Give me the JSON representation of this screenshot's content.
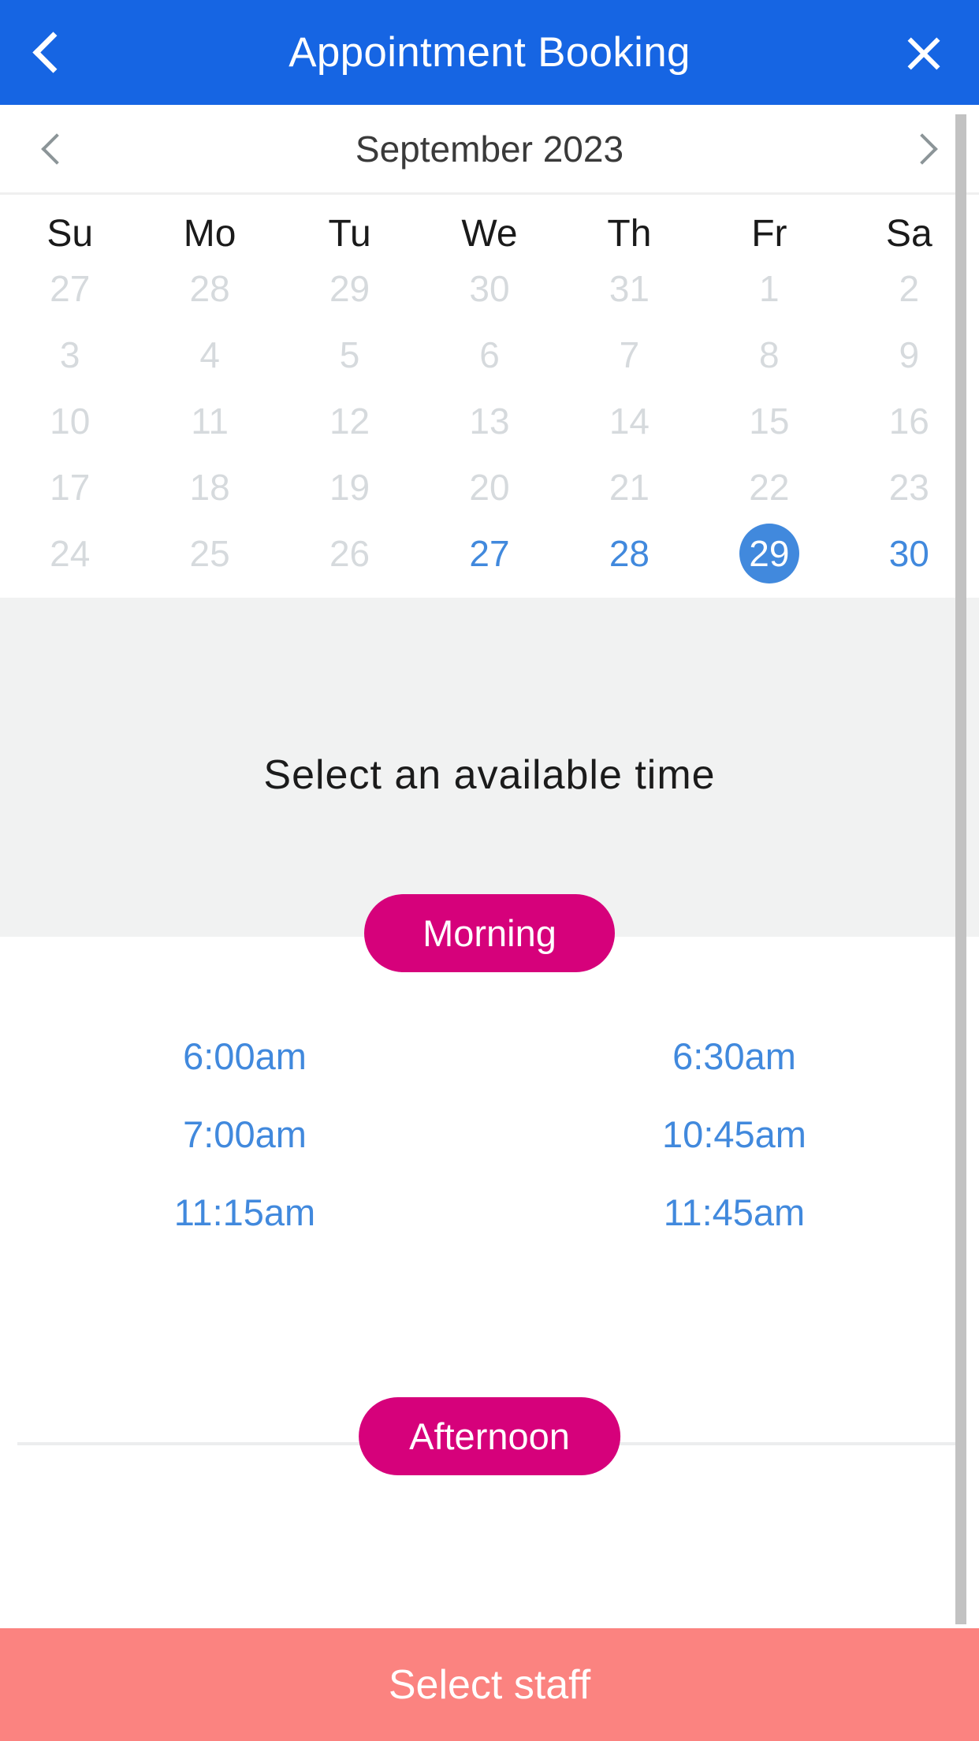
{
  "header": {
    "title": "Appointment Booking",
    "back_icon": "chevron-left-icon",
    "close_icon": "close-icon",
    "background_color": "#1665E3"
  },
  "calendar": {
    "month_label": "September 2023",
    "prev_icon": "chevron-left-icon",
    "next_icon": "chevron-right-icon",
    "weekdays": [
      "Su",
      "Mo",
      "Tu",
      "We",
      "Th",
      "Fr",
      "Sa"
    ],
    "days": [
      {
        "label": "27",
        "state": "disabled"
      },
      {
        "label": "28",
        "state": "disabled"
      },
      {
        "label": "29",
        "state": "disabled"
      },
      {
        "label": "30",
        "state": "disabled"
      },
      {
        "label": "31",
        "state": "disabled"
      },
      {
        "label": "1",
        "state": "disabled"
      },
      {
        "label": "2",
        "state": "disabled"
      },
      {
        "label": "3",
        "state": "disabled"
      },
      {
        "label": "4",
        "state": "disabled"
      },
      {
        "label": "5",
        "state": "disabled"
      },
      {
        "label": "6",
        "state": "disabled"
      },
      {
        "label": "7",
        "state": "disabled"
      },
      {
        "label": "8",
        "state": "disabled"
      },
      {
        "label": "9",
        "state": "disabled"
      },
      {
        "label": "10",
        "state": "disabled"
      },
      {
        "label": "11",
        "state": "disabled"
      },
      {
        "label": "12",
        "state": "disabled"
      },
      {
        "label": "13",
        "state": "disabled"
      },
      {
        "label": "14",
        "state": "disabled"
      },
      {
        "label": "15",
        "state": "disabled"
      },
      {
        "label": "16",
        "state": "disabled"
      },
      {
        "label": "17",
        "state": "disabled"
      },
      {
        "label": "18",
        "state": "disabled"
      },
      {
        "label": "19",
        "state": "disabled"
      },
      {
        "label": "20",
        "state": "disabled"
      },
      {
        "label": "21",
        "state": "disabled"
      },
      {
        "label": "22",
        "state": "disabled"
      },
      {
        "label": "23",
        "state": "disabled"
      },
      {
        "label": "24",
        "state": "disabled"
      },
      {
        "label": "25",
        "state": "disabled"
      },
      {
        "label": "26",
        "state": "disabled"
      },
      {
        "label": "27",
        "state": "enabled"
      },
      {
        "label": "28",
        "state": "enabled"
      },
      {
        "label": "29",
        "state": "selected"
      },
      {
        "label": "30",
        "state": "enabled"
      }
    ],
    "selected_day": "29",
    "selected_color": "#4189DD",
    "enabled_color": "#4189DD",
    "disabled_color": "#d6dadd"
  },
  "time_picker": {
    "title": "Select an available time",
    "morning_label": "Morning",
    "afternoon_label": "Afternoon",
    "period_pill_color": "#D6017B",
    "slot_color": "#4189DD",
    "slots": [
      "6:00am",
      "6:30am",
      "7:00am",
      "10:45am",
      "11:15am",
      "11:45am"
    ]
  },
  "bottom_bar": {
    "label": "Select staff",
    "background_color": "#FB8380"
  },
  "scrollbar": {
    "color": "#C2C2C2"
  }
}
